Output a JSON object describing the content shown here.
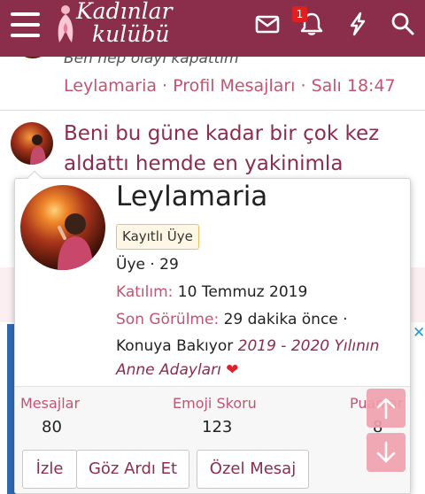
{
  "header": {
    "logo_line1": "Kadınlar",
    "logo_line2": "kulübü",
    "notification_count": "1",
    "icons": [
      "menu-icon",
      "mail-icon",
      "bell-icon",
      "bolt-icon",
      "search-icon"
    ]
  },
  "feed": {
    "item1": {
      "text": "Ben hep olayı kapattım",
      "meta": "Leylamaria · Profil Mesajları · Salı 18:47"
    },
    "item2": {
      "text": "Beni bu güne kadar bir çok kez aldattı hemde en yakinimla"
    }
  },
  "member_card": {
    "name": "Leylamaria",
    "role": "Kayıtlı Üye",
    "title_line": "Üye · 29",
    "joined_label": "Katılım:",
    "joined_value": "10 Temmuz 2019",
    "last_seen_label": "Son Görülme:",
    "last_seen_value": "29 dakika önce ·",
    "activity_prefix": "Konuya Bakıyor",
    "activity_link": "2019 - 2020 Yılının Anne Adayları",
    "activity_emoji": "❤",
    "stats": [
      {
        "label": "Mesajlar",
        "value": "80"
      },
      {
        "label": "Emoji Skoru",
        "value": "123"
      },
      {
        "label": "Puanlar",
        "value": "8"
      }
    ],
    "buttons": {
      "follow": "İzle",
      "ignore": "Göz Ardı Et",
      "private_message": "Özel Mesaj"
    }
  },
  "colors": {
    "brand": "#8a2e4c",
    "accent": "#c25471",
    "badge_bg": "#fff7e6",
    "badge_border": "#e8c16a",
    "scroll_button": "#f0a0ad"
  }
}
